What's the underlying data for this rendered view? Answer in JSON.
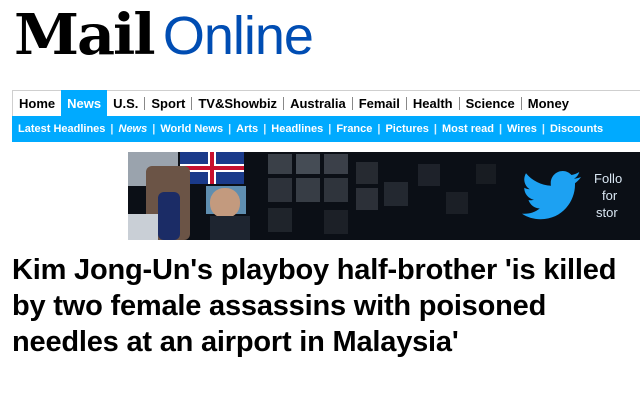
{
  "logo": {
    "part1": "Mail",
    "part2": "Online"
  },
  "nav": {
    "items": [
      "Home",
      "News",
      "U.S.",
      "Sport",
      "TV&Showbiz",
      "Australia",
      "Femail",
      "Health",
      "Science",
      "Money"
    ],
    "active": "News"
  },
  "subnav": {
    "items": [
      "Latest Headlines",
      "News",
      "World News",
      "Arts",
      "Headlines",
      "France",
      "Pictures",
      "Most read",
      "Wires",
      "Discounts"
    ]
  },
  "banner": {
    "follow_text_lines": [
      "Follo",
      "for",
      "stor"
    ],
    "icon": "twitter-bird-icon"
  },
  "article": {
    "headline": "Kim Jong-Un's playboy half-brother 'is killed by two female assassins with poisoned needles at an airport in Malaysia'"
  },
  "colors": {
    "accent": "#00aaff",
    "logo_online": "#004db3"
  }
}
